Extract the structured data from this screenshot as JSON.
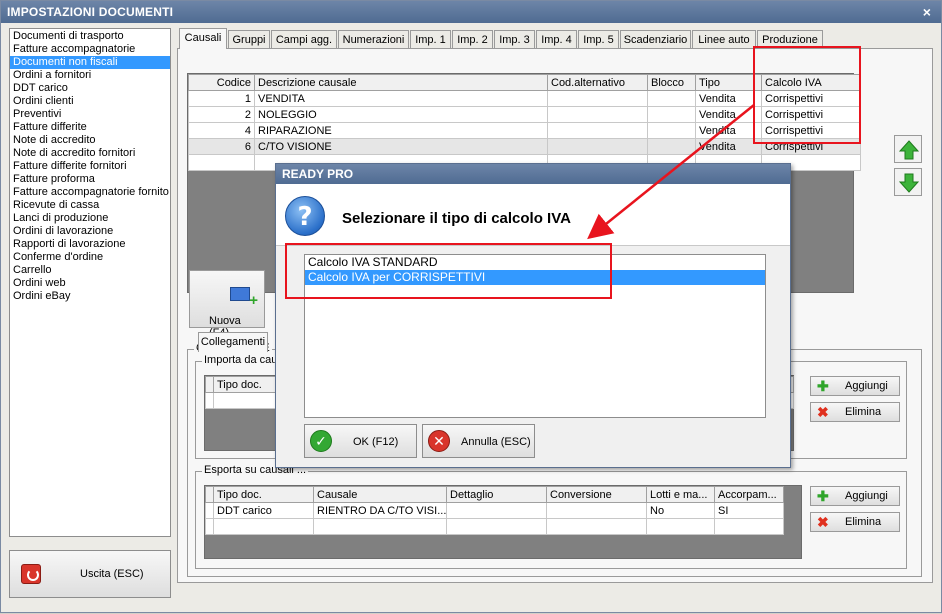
{
  "window": {
    "title": "IMPOSTAZIONI DOCUMENTI",
    "close_glyph": "×"
  },
  "doc_list": {
    "items": [
      "Documenti di trasporto",
      "Fatture accompagnatorie",
      "Documenti non fiscali",
      "Ordini a fornitori",
      "DDT carico",
      "Ordini clienti",
      "Preventivi",
      "Fatture differite",
      "Note di accredito",
      "Note di accredito fornitori",
      "Fatture differite fornitori",
      "Fatture proforma",
      "Fatture accompagnatorie fornito",
      "Ricevute di cassa",
      "Lanci di produzione",
      "Ordini di lavorazione",
      "Rapporti di lavorazione",
      "Conferme d'ordine",
      "Carrello",
      "Ordini web",
      "Ordini eBay"
    ],
    "selected_index": 2
  },
  "exit_button": {
    "label": "Uscita (ESC)",
    "icon": "power-icon"
  },
  "tabs": [
    "Causali",
    "Gruppi",
    "Campi agg.",
    "Numerazioni",
    "Imp. 1",
    "Imp. 2",
    "Imp. 3",
    "Imp. 4",
    "Imp. 5",
    "Scadenziario",
    "Linee auto",
    "Produzione"
  ],
  "active_tab": "Causali",
  "causali_table": {
    "headers": [
      "Codice",
      "Descrizione causale",
      "Cod.alternativo",
      "Blocco",
      "Tipo",
      "Calcolo IVA"
    ],
    "rows": [
      [
        "1",
        "VENDITA",
        "",
        "",
        "Vendita",
        "Corrispettivi"
      ],
      [
        "2",
        "NOLEGGIO",
        "",
        "",
        "Vendita",
        "Corrispettivi"
      ],
      [
        "4",
        "RIPARAZIONE",
        "",
        "",
        "Vendita",
        "Corrispettivi"
      ],
      [
        "6",
        "C/TO VISIONE",
        "",
        "",
        "Vendita",
        "Corrispettivi"
      ]
    ]
  },
  "move_buttons": {
    "up_icon": "arrow-up-icon",
    "down_icon": "arrow-down-icon"
  },
  "new_button": {
    "label": "Nuova (F4)",
    "icon": "new-document-icon"
  },
  "detail": {
    "group_title": "C/TO VISIONE",
    "subtab": "Collegamenti",
    "importa_label": "Importa da cau",
    "importa_headers": [
      "Tipo doc."
    ],
    "esporta_label": "Esporta su causali ...",
    "esporta_headers": [
      "Tipo doc.",
      "Causale",
      "Dettaglio",
      "Conversione",
      "Lotti e ma...",
      "Accorpam..."
    ],
    "esporta_rows": [
      [
        "DDT carico",
        "RIENTRO DA C/TO VISI...",
        "",
        "",
        "No",
        "SI"
      ]
    ],
    "add_label": "Aggiungi",
    "delete_label": "Elimina"
  },
  "dialog": {
    "title": "READY PRO",
    "heading": "Selezionare il tipo di calcolo IVA",
    "icon": "question-icon",
    "options": [
      "Calcolo IVA STANDARD",
      "Calcolo IVA per CORRISPETTIVI"
    ],
    "selected_index": 1,
    "ok_label": "OK (F12)",
    "cancel_label": "Annulla (ESC)"
  },
  "colors": {
    "highlight": "#3399ff",
    "annotation": "#e8141e",
    "titlebar": "#5a7398"
  }
}
